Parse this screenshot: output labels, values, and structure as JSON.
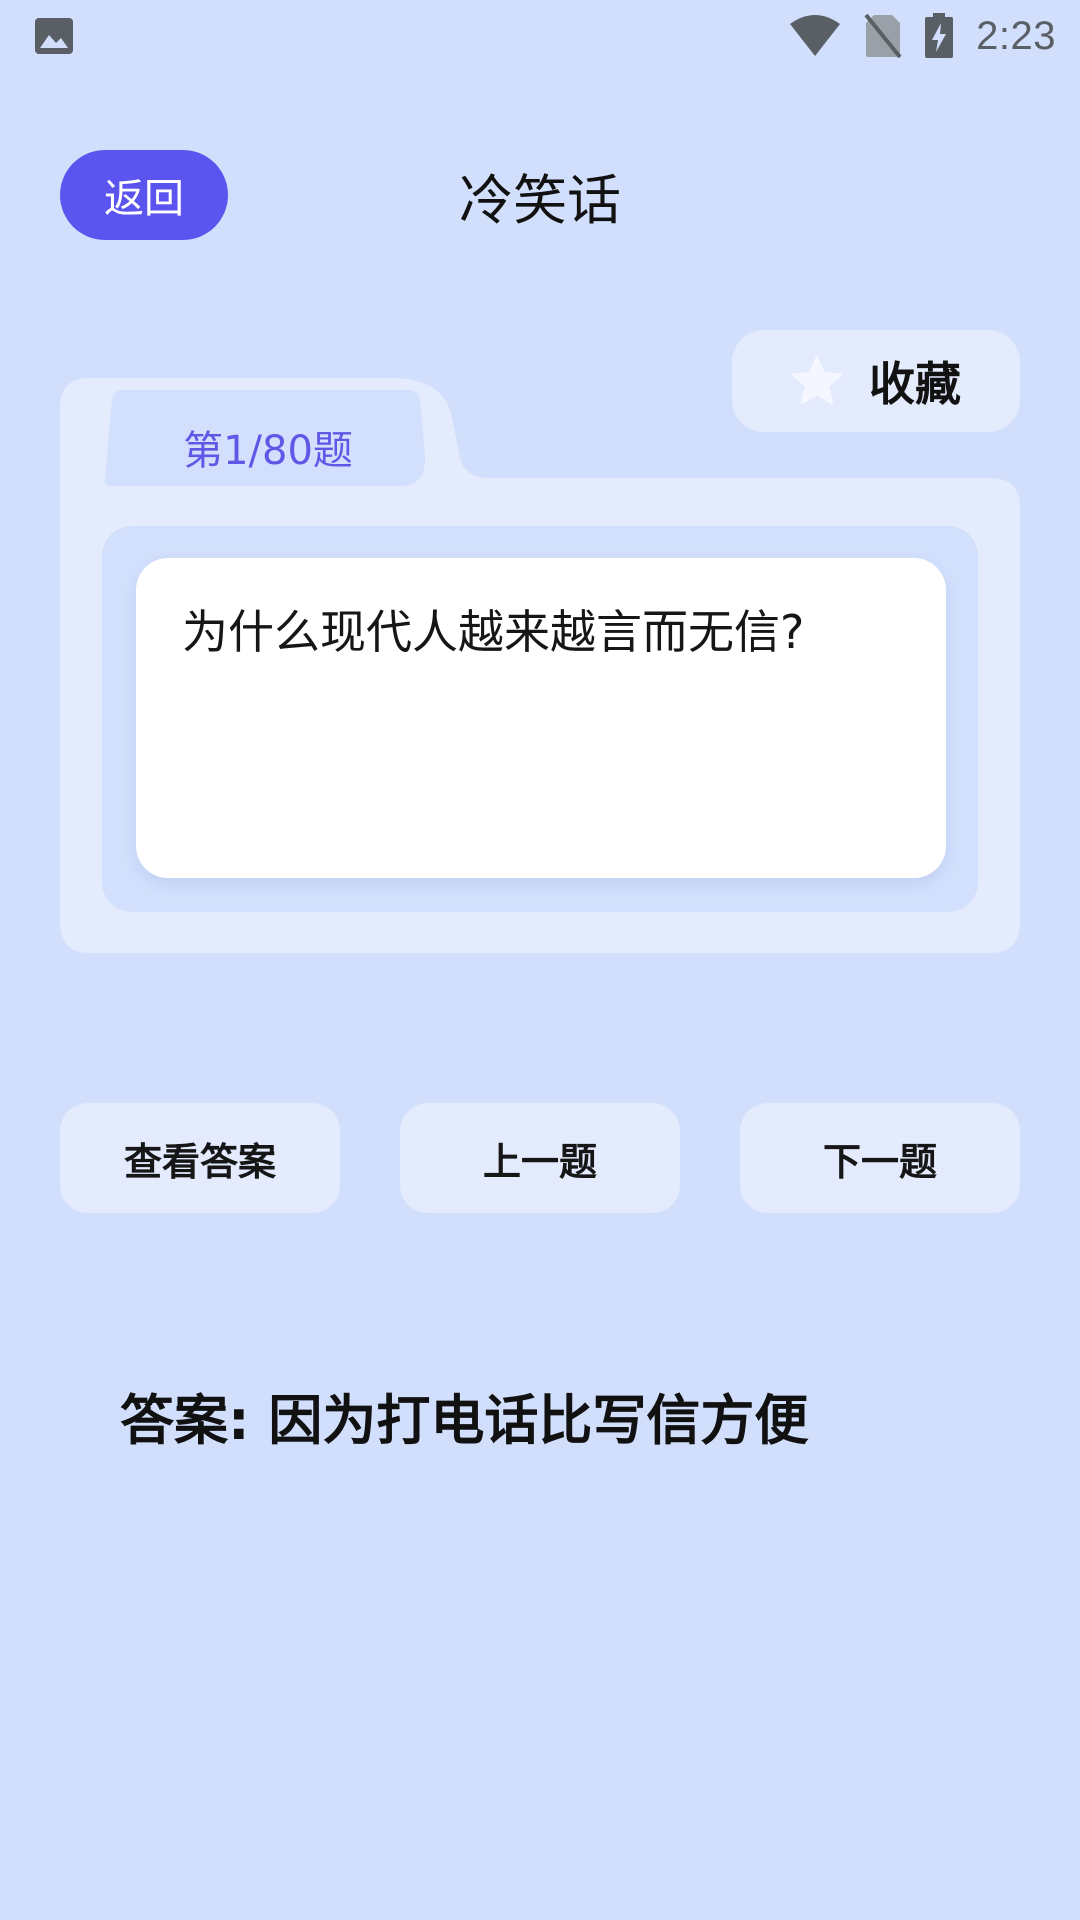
{
  "status_bar": {
    "time": "2:23",
    "left_icon": "image-icon",
    "icons": [
      "wifi-icon",
      "no-sim-icon",
      "battery-charging-icon"
    ]
  },
  "header": {
    "back_label": "返回",
    "title": "冷笑话"
  },
  "favorite": {
    "label": "收藏",
    "icon": "star-icon"
  },
  "question": {
    "tab_label": "第1/80题",
    "text": "为什么现代人越来越言而无信?"
  },
  "actions": {
    "show_answer": "查看答案",
    "previous": "上一题",
    "next": "下一题"
  },
  "answer": {
    "prefix": "答案: ",
    "text": "因为打电话比写信方便"
  },
  "colors": {
    "background": "#d1dffd",
    "accent": "#5b54ee",
    "card_light": "#e3ebfd",
    "tab_text": "#5f58e6"
  }
}
